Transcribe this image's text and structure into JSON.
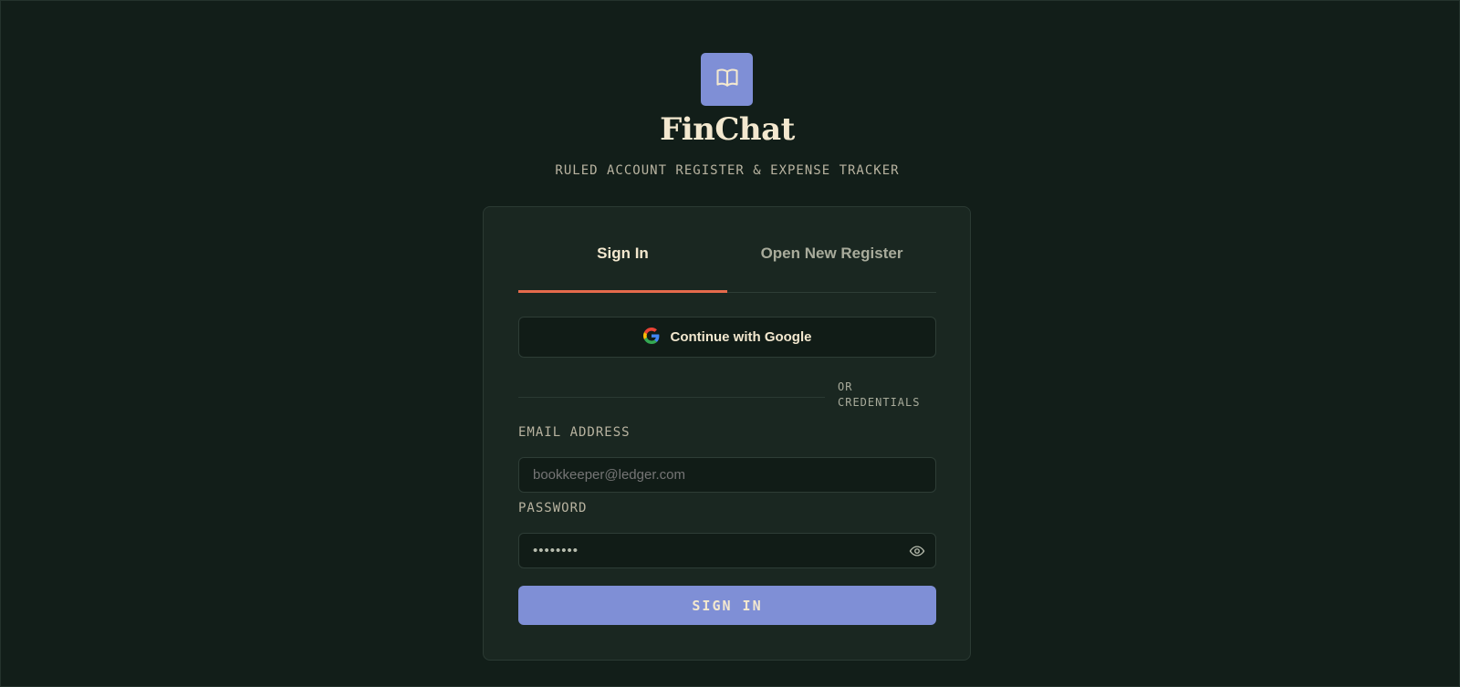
{
  "app": {
    "name": "FinChat",
    "tagline": "RULED ACCOUNT REGISTER & EXPENSE TRACKER",
    "logo_icon": "open-book-icon"
  },
  "colors": {
    "background": "#121e19",
    "card": "#1a2721",
    "accent": "#7f8fd6",
    "tab_underline": "#e56a4c",
    "heading_text": "#f3e8cf"
  },
  "tabs": [
    {
      "label": "Sign In",
      "active": true
    },
    {
      "label": "Open New Register",
      "active": false
    }
  ],
  "google_button": {
    "label": "Continue with Google",
    "icon": "google-icon"
  },
  "divider": {
    "text": "OR CREDENTIALS"
  },
  "email": {
    "label": "EMAIL ADDRESS",
    "placeholder": "bookkeeper@ledger.com",
    "value": ""
  },
  "password": {
    "label": "PASSWORD",
    "value": "••••••••",
    "toggle_icon": "eye-icon"
  },
  "submit": {
    "label": "SIGN IN"
  }
}
